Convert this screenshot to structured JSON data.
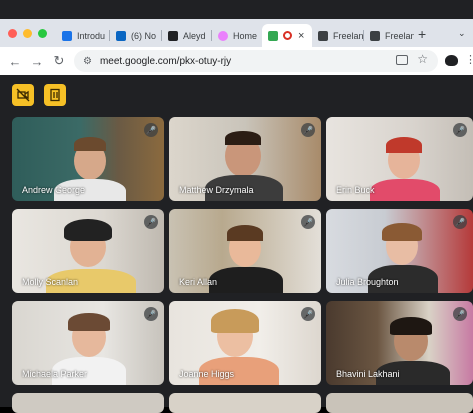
{
  "browser": {
    "tabs": [
      {
        "label": "Introdu",
        "color": "#1a73e8"
      },
      {
        "label": "(6) No",
        "color": "#0a66c2"
      },
      {
        "label": "Aleyd",
        "color": "#202124"
      },
      {
        "label": "Home",
        "color": "#ea80fc"
      },
      {
        "label": "",
        "color": "#34a853"
      },
      {
        "label": "Freelan",
        "color": "#3c4043"
      },
      {
        "label": "Freelan",
        "color": "#3c4043"
      }
    ],
    "new_tab": "+",
    "close_glyph": "×",
    "url": "meet.google.com/pkx-otuy-rjy"
  },
  "meet": {
    "participants": [
      {
        "name": "Andrew George"
      },
      {
        "name": "Matthew Drzymala"
      },
      {
        "name": "Erin Buck"
      },
      {
        "name": "Molly Scanlan"
      },
      {
        "name": "Keri Allan"
      },
      {
        "name": "Julia Broughton"
      },
      {
        "name": "Michaela Parker"
      },
      {
        "name": "Joanne Higgs"
      },
      {
        "name": "Bhavini Lakhani"
      }
    ]
  },
  "colors": {
    "meet_bg": "#202124",
    "button_yellow": "#f6c026",
    "tabstrip": "#dfe3ea"
  }
}
